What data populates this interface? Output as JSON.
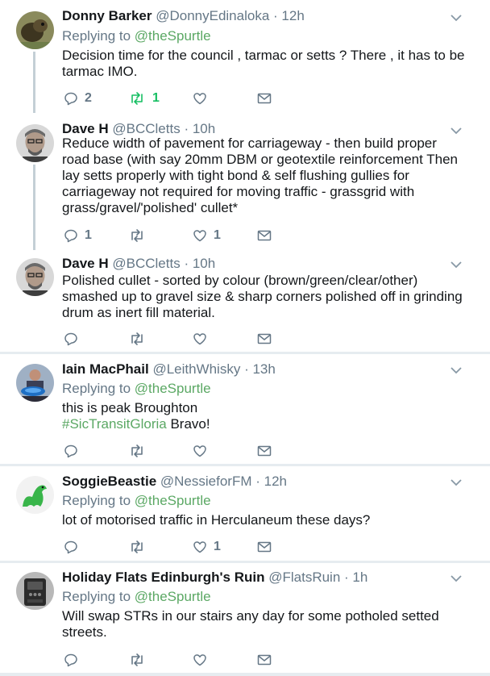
{
  "tweets": [
    {
      "name": "Donny Barker",
      "handle": "@DonnyEdinaloka",
      "time": "· 12h",
      "replying_prefix": "Replying to",
      "replying_to": "@theSpurtle",
      "text": "Decision time for the council , tarmac or setts ?  There , it has to be tarmac IMO.",
      "reply_count": "2",
      "retweet_count": "1",
      "like_count": ""
    },
    {
      "name": "Dave H",
      "handle": "@BCCletts",
      "time": "· 10h",
      "text": "Reduce width of pavement for carriageway - then build proper road base (with say 20mm DBM or geotextile reinforcement Then lay setts properly with tight bond & self flushing gullies for carriageway not required for moving traffic - grassgrid with grass/gravel/'polished' cullet*",
      "reply_count": "1",
      "retweet_count": "",
      "like_count": "1"
    },
    {
      "name": "Dave H",
      "handle": "@BCCletts",
      "time": "· 10h",
      "text": "Polished cullet - sorted by colour (brown/green/clear/other) smashed up to gravel size & sharp corners polished off in grinding drum as inert fill material.",
      "reply_count": "",
      "retweet_count": "",
      "like_count": ""
    },
    {
      "name": "Iain MacPhail",
      "handle": "@LeithWhisky",
      "time": "· 13h",
      "replying_prefix": "Replying to",
      "replying_to": "@theSpurtle",
      "text": "this is peak Broughton",
      "hashtag": "#SicTransitGloria",
      "text_after": " Bravo!",
      "reply_count": "",
      "retweet_count": "",
      "like_count": ""
    },
    {
      "name": "SoggieBeastie",
      "handle": "@NessieforFM",
      "time": "· 12h",
      "replying_prefix": "Replying to",
      "replying_to": "@theSpurtle",
      "text": "lot of motorised traffic in Herculaneum these days?",
      "reply_count": "",
      "retweet_count": "",
      "like_count": "1"
    },
    {
      "name": "Holiday Flats Edinburgh's Ruin",
      "handle": "@FlatsRuin",
      "time": "· 1h",
      "replying_prefix": "Replying to",
      "replying_to": "@theSpurtle",
      "text": "Will swap STRs in our stairs any day for some potholed setted streets.",
      "reply_count": "",
      "retweet_count": "",
      "like_count": ""
    }
  ],
  "colors": {
    "name": "#14171a",
    "secondary": "#657786",
    "mention": "#5ba864",
    "retweet_active": "#17bf63",
    "divider": "#e6ecf0"
  },
  "icons": [
    "reply-icon",
    "retweet-icon",
    "like-icon",
    "dm-icon",
    "chevron-down-icon"
  ]
}
